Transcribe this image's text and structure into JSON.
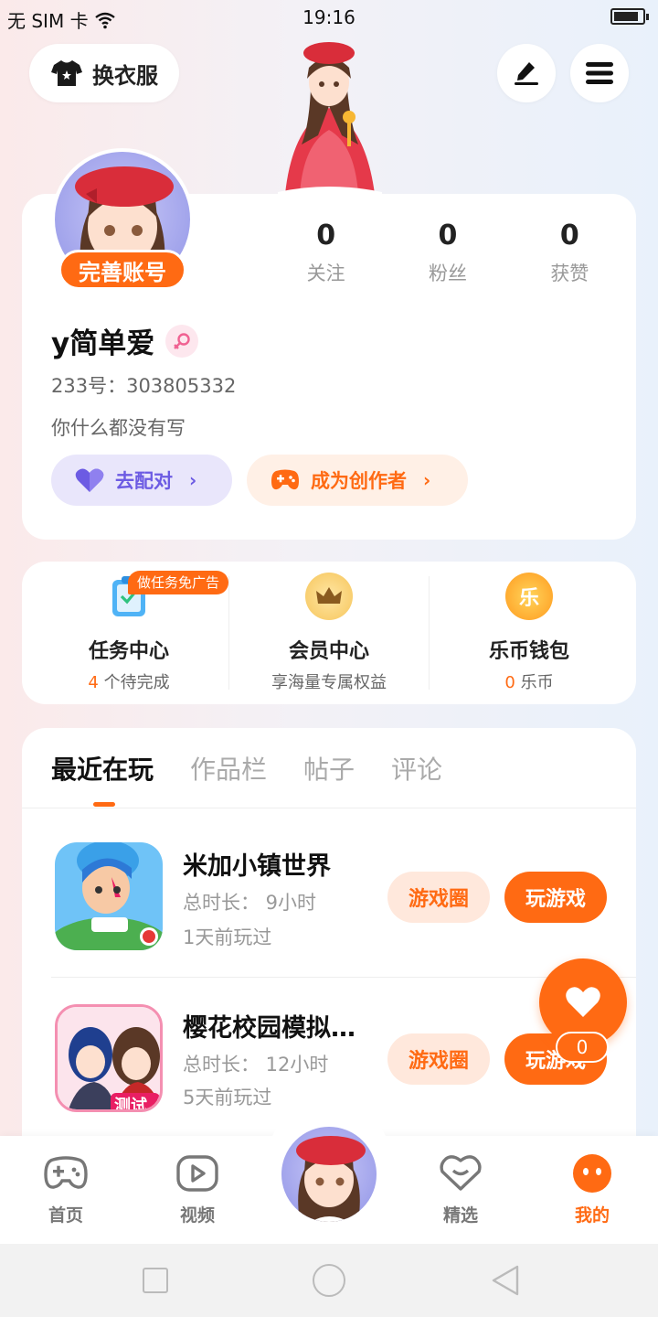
{
  "status_bar": {
    "carrier": "无 SIM 卡",
    "time": "19:16"
  },
  "header": {
    "dress_label": "换衣服"
  },
  "profile": {
    "complete_badge": "完善账号",
    "stats": [
      {
        "num": "0",
        "label": "关注"
      },
      {
        "num": "0",
        "label": "粉丝"
      },
      {
        "num": "0",
        "label": "获赞"
      }
    ],
    "username": "y简单爱",
    "uid": "233号：303805332",
    "bio": "你什么都没有写",
    "match_label": "去配对",
    "creator_label": "成为创作者"
  },
  "services": {
    "task_badge": "做任务免广告",
    "items": [
      {
        "title": "任务中心",
        "count": "4",
        "sub": " 个待完成"
      },
      {
        "title": "会员中心",
        "count": "",
        "sub": "享海量专属权益"
      },
      {
        "title": "乐币钱包",
        "count": "0",
        "sub": " 乐币"
      }
    ],
    "coin_glyph": "乐"
  },
  "tabs": [
    "最近在玩",
    "作品栏",
    "帖子",
    "评论"
  ],
  "games": [
    {
      "name": "米加小镇世界",
      "duration": "总时长：  9小时",
      "last_played": "1天前玩过",
      "circle_label": "游戏圈",
      "play_label": "玩游戏"
    },
    {
      "name": "樱花校园模拟…",
      "duration": "总时长：  12小时",
      "last_played": "5天前玩过",
      "circle_label": "游戏圈",
      "play_label": "玩游戏",
      "badge": "测试版"
    }
  ],
  "like_count": "0",
  "bottom_nav": [
    {
      "label": "首页"
    },
    {
      "label": "视频"
    },
    {
      "label": "精选"
    },
    {
      "label": "我的"
    }
  ],
  "colors": {
    "accent": "#ff6a13",
    "match": "#6c5be3",
    "avatar_bg": "#8f93e6"
  }
}
